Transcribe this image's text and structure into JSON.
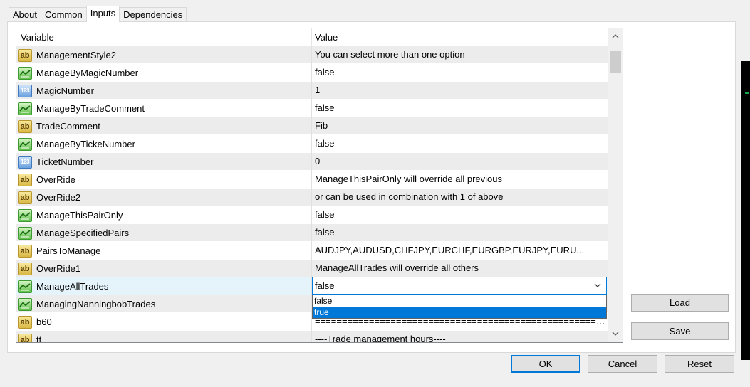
{
  "tabs": [
    "About",
    "Common",
    "Inputs",
    "Dependencies"
  ],
  "grid": {
    "headers": {
      "variable": "Variable",
      "value": "Value"
    },
    "rows": [
      {
        "type": "ab",
        "name": "ManagementStyle2",
        "value": "You can select more than one option"
      },
      {
        "type": "bool",
        "name": "ManageByMagicNumber",
        "value": "false"
      },
      {
        "type": "num",
        "name": "MagicNumber",
        "value": "1"
      },
      {
        "type": "bool",
        "name": "ManageByTradeComment",
        "value": "false"
      },
      {
        "type": "ab",
        "name": "TradeComment",
        "value": "Fib"
      },
      {
        "type": "bool",
        "name": "ManageByTickeNumber",
        "value": "false"
      },
      {
        "type": "num",
        "name": "TicketNumber",
        "value": "0"
      },
      {
        "type": "ab",
        "name": "OverRide",
        "value": "ManageThisPairOnly will override all previous"
      },
      {
        "type": "ab",
        "name": "OverRide2",
        "value": "or can be used in combination with 1 of above"
      },
      {
        "type": "bool",
        "name": "ManageThisPairOnly",
        "value": "false"
      },
      {
        "type": "bool",
        "name": "ManageSpecifiedPairs",
        "value": "false"
      },
      {
        "type": "ab",
        "name": "PairsToManage",
        "value": "AUDJPY,AUDUSD,CHFJPY,EURCHF,EURGBP,EURJPY,EURU..."
      },
      {
        "type": "ab",
        "name": "OverRide1",
        "value": "ManageAllTrades will override all others"
      },
      {
        "type": "bool",
        "name": "ManageAllTrades",
        "value": ""
      },
      {
        "type": "bool",
        "name": "ManagingNanningbobTrades",
        "value": ""
      },
      {
        "type": "ab",
        "name": "b60",
        "value": "=========================================================..."
      },
      {
        "type": "ab",
        "name": "tt",
        "value": "----Trade management hours----"
      }
    ]
  },
  "combo": {
    "selected": "false",
    "options": [
      "false",
      "true"
    ],
    "highlighted": "true"
  },
  "icons": {
    "ab": "ab",
    "bool": "bool-icon",
    "num": "123"
  },
  "buttons": {
    "load": "Load",
    "save": "Save",
    "ok": "OK",
    "cancel": "Cancel",
    "reset": "Reset"
  }
}
